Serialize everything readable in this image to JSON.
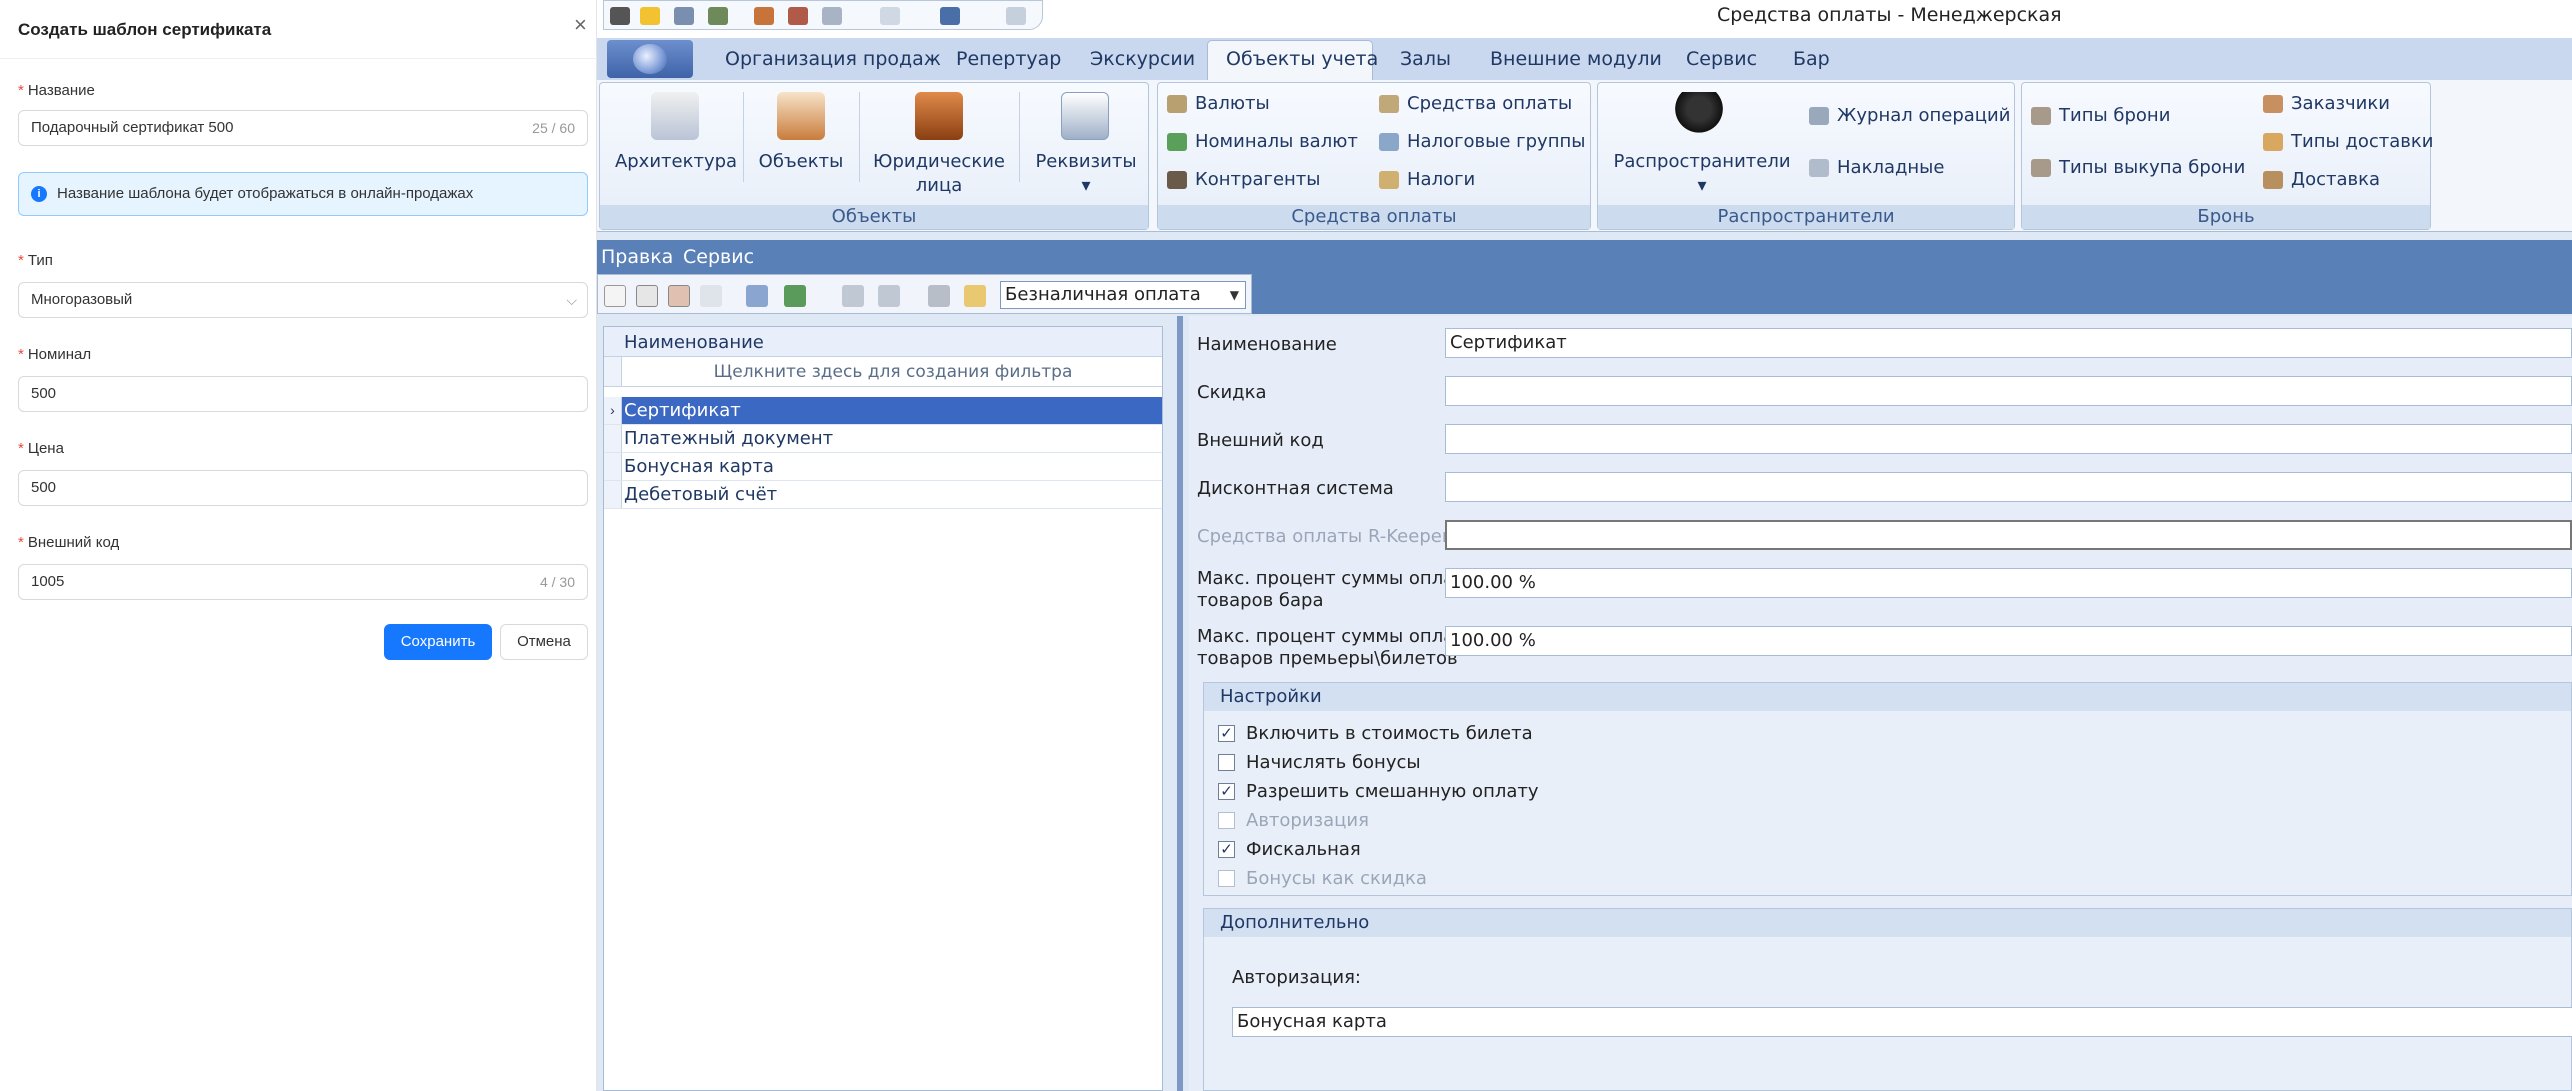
{
  "drawer": {
    "title": "Создать шаблон сертификата",
    "name_label": "Название",
    "name_value": "Подарочный сертификат 500",
    "name_count": "25 / 60",
    "info": "Название шаблона будет отображаться в онлайн-продажах",
    "type_label": "Тип",
    "type_value": "Многоразовый",
    "nominal_label": "Номинал",
    "nominal_value": "500",
    "price_label": "Цена",
    "price_value": "500",
    "extcode_label": "Внешний код",
    "extcode_value": "1005",
    "extcode_count": "4 / 30",
    "save": "Сохранить",
    "cancel": "Отмена"
  },
  "app": {
    "title": "Средства оплаты - Менеджерская",
    "tabs": [
      "Организация продаж",
      "Репертуар",
      "Экскурсии",
      "Объекты учета",
      "Залы",
      "Внешние модули",
      "Сервис",
      "Бар"
    ],
    "ribbon": {
      "objects": {
        "label": "Объекты",
        "architecture": "Архитектура",
        "objects": "Объекты",
        "legal1": "Юридические",
        "legal2": "лица",
        "requisites": "Реквизиты"
      },
      "payment": {
        "label": "Средства оплаты",
        "currencies": "Валюты",
        "denominations": "Номиналы валют",
        "contractors": "Контрагенты",
        "payment_means": "Средства оплаты",
        "tax_groups": "Налоговые группы",
        "taxes": "Налоги"
      },
      "distributors": {
        "label": "Распространители",
        "distributors": "Распространители",
        "journal": "Журнал операций",
        "invoices": "Накладные"
      },
      "booking": {
        "label": "Бронь",
        "booking_types": "Типы брони",
        "buyout_types": "Типы выкупа брони",
        "customers": "Заказчики",
        "delivery_types": "Типы доставки",
        "delivery": "Доставка"
      }
    },
    "menu": [
      "Правка",
      "Сервис"
    ],
    "combo": "Безналичная оплата",
    "grid": {
      "header": "Наименование",
      "filter": "Щелкните здесь для создания фильтра",
      "rows": [
        "Сертификат",
        "Платежный документ",
        "Бонусная карта",
        "Дебетовый счёт"
      ]
    },
    "form": {
      "name_label": "Наименование",
      "name_value": "Сертификат",
      "discount_label": "Скидка",
      "extcode_label": "Внешний код",
      "discount_system_label": "Дисконтная система",
      "rkeeper_label": "Средства оплаты R-Keeper",
      "max_bar_label1": "Макс. процент суммы оплаты",
      "max_bar_label2": "товаров бара",
      "max_bar_value": "100.00 %",
      "max_prem_label1": "Макс. процент суммы оплаты",
      "max_prem_label2": "товаров премьеры\\билетов",
      "max_prem_value": "100.00 %",
      "settings_header": "Настройки",
      "checks": [
        {
          "label": "Включить в стоимость билета",
          "checked": true
        },
        {
          "label": "Начислять бонусы",
          "checked": false
        },
        {
          "label": "Разрешить смешанную оплату",
          "checked": true
        },
        {
          "label": "Авторизация",
          "checked": false
        },
        {
          "label": "Фискальная",
          "checked": true
        },
        {
          "label": "Бонусы как скидка",
          "checked": false
        }
      ],
      "extra_header": "Дополнительно",
      "auth_label": "Авторизация:",
      "auth_value": "Бонусная карта"
    }
  }
}
